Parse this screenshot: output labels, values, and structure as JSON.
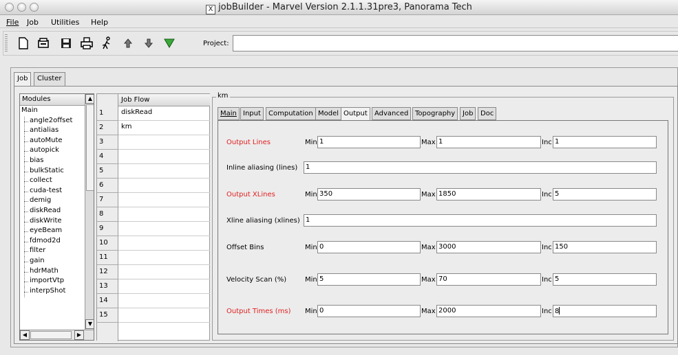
{
  "window": {
    "title": "jobBuilder - Marvel Version 2.1.1.31pre3, Panorama Tech"
  },
  "menu": [
    "File",
    "Job",
    "Utilities",
    "Help"
  ],
  "toolbar": {
    "icons": [
      "new-document-icon",
      "open-icon",
      "save-icon",
      "print-icon",
      "run-icon",
      "move-up-icon",
      "move-down-icon",
      "filter-icon"
    ],
    "project_label": "Project:",
    "project_value": ""
  },
  "outer_tabs": [
    "Job",
    "Cluster"
  ],
  "modules": {
    "header": "Modules",
    "root": "Main",
    "items": [
      "angle2offset",
      "antialias",
      "autoMute",
      "autopick",
      "bias",
      "bulkStatic",
      "collect",
      "cuda-test",
      "demig",
      "diskRead",
      "diskWrite",
      "eyeBeam",
      "fdmod2d",
      "filter",
      "gain",
      "hdrMath",
      "importVtp",
      "interpShot"
    ]
  },
  "job_flow": {
    "header": "Job Flow",
    "rows": [
      {
        "num": "1",
        "value": "diskRead"
      },
      {
        "num": "2",
        "value": "km"
      },
      {
        "num": "3",
        "value": ""
      },
      {
        "num": "4",
        "value": ""
      },
      {
        "num": "5",
        "value": ""
      },
      {
        "num": "6",
        "value": ""
      },
      {
        "num": "7",
        "value": ""
      },
      {
        "num": "8",
        "value": ""
      },
      {
        "num": "9",
        "value": ""
      },
      {
        "num": "10",
        "value": ""
      },
      {
        "num": "11",
        "value": ""
      },
      {
        "num": "12",
        "value": ""
      },
      {
        "num": "13",
        "value": ""
      },
      {
        "num": "14",
        "value": ""
      },
      {
        "num": "15",
        "value": ""
      }
    ]
  },
  "km": {
    "title": "km",
    "tabs": [
      "Main",
      "Input",
      "Computation",
      "Model",
      "Output",
      "Advanced",
      "Topography",
      "Job",
      "Doc"
    ],
    "active_tab": "Output",
    "accent_color": "#e02020",
    "labels": {
      "min": "Min",
      "max": "Max",
      "inc": "Inc"
    },
    "fields": {
      "output_lines": {
        "label": "Output Lines",
        "min": "1",
        "max": "1",
        "inc": "1"
      },
      "inline_aliasing": {
        "label": "Inline aliasing (lines)",
        "value": "1"
      },
      "output_xlines": {
        "label": "Output XLines",
        "min": "350",
        "max": "1850",
        "inc": "5"
      },
      "xline_aliasing": {
        "label": "Xline aliasing (xlines)",
        "value": "1"
      },
      "offset_bins": {
        "label": "Offset Bins",
        "min": "0",
        "max": "3000",
        "inc": "150"
      },
      "velocity_scan": {
        "label": "Velocity Scan (%)",
        "min": "5",
        "max": "70",
        "inc": "5"
      },
      "output_times": {
        "label": "Output Times (ms)",
        "min": "0",
        "max": "2000",
        "inc": "8"
      }
    }
  }
}
